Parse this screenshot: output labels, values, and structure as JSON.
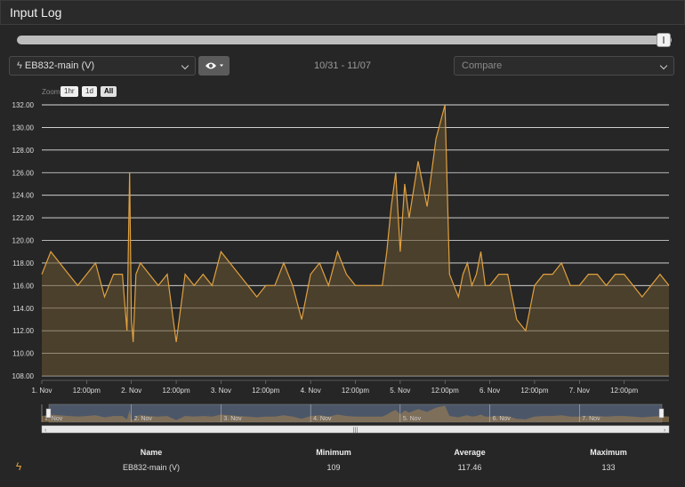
{
  "header": {
    "title": "Input Log"
  },
  "device_select": {
    "value": "EB832-main (V)"
  },
  "date_range": "10/31 - 11/07",
  "compare_select": {
    "placeholder": "Compare"
  },
  "zoom": {
    "label": "Zoom",
    "buttons": [
      "1hr",
      "1d",
      "All"
    ],
    "active": "All"
  },
  "colors": {
    "line": "#e0a040",
    "fill": "#6a5530",
    "grid": "#e6e6e6",
    "navigator": "#6a7ea0"
  },
  "chart_data": {
    "type": "area",
    "ylim": [
      108,
      132
    ],
    "yticks": [
      "108.00",
      "110.00",
      "112.00",
      "114.00",
      "116.00",
      "118.00",
      "120.00",
      "122.00",
      "124.00",
      "126.00",
      "128.00",
      "130.00",
      "132.00"
    ],
    "xticks": [
      "1. Nov",
      "12:00pm",
      "2. Nov",
      "12:00pm",
      "3. Nov",
      "12:00pm",
      "4. Nov",
      "12:00pm",
      "5. Nov",
      "12:00pm",
      "6. Nov",
      "12:00pm",
      "7. Nov",
      "12:00pm"
    ],
    "navigator_ticks": [
      "1. Nov",
      "2. Nov",
      "3. Nov",
      "4. Nov",
      "5. Nov",
      "6. Nov",
      "7. Nov"
    ],
    "x_days": [
      0,
      0.1,
      0.2,
      0.3,
      0.4,
      0.5,
      0.6,
      0.7,
      0.8,
      0.9,
      0.95,
      0.98,
      1.0,
      1.02,
      1.05,
      1.1,
      1.2,
      1.3,
      1.4,
      1.5,
      1.6,
      1.7,
      1.8,
      1.9,
      2.0,
      2.1,
      2.2,
      2.3,
      2.4,
      2.5,
      2.6,
      2.7,
      2.8,
      2.9,
      3.0,
      3.1,
      3.2,
      3.3,
      3.4,
      3.5,
      3.6,
      3.7,
      3.8,
      3.85,
      3.9,
      3.95,
      4.0,
      4.05,
      4.1,
      4.2,
      4.3,
      4.4,
      4.5,
      4.55,
      4.6,
      4.65,
      4.7,
      4.75,
      4.8,
      4.85,
      4.9,
      4.95,
      5.0,
      5.1,
      5.2,
      5.3,
      5.4,
      5.5,
      5.6,
      5.7,
      5.8,
      5.9,
      6.0,
      6.1,
      6.2,
      6.3,
      6.4,
      6.5,
      6.6,
      6.7,
      6.8,
      6.9,
      7.0
    ],
    "values": [
      117,
      119,
      118,
      117,
      116,
      117,
      118,
      115,
      117,
      117,
      112,
      126,
      113,
      111,
      117,
      118,
      117,
      116,
      117,
      111,
      117,
      116,
      117,
      116,
      119,
      118,
      117,
      116,
      115,
      116,
      116,
      118,
      116,
      113,
      117,
      118,
      116,
      119,
      117,
      116,
      116,
      116,
      116,
      119,
      123,
      126,
      119,
      125,
      122,
      127,
      123,
      129,
      132,
      117,
      116,
      115,
      117,
      118,
      116,
      117,
      119,
      116,
      116,
      117,
      117,
      113,
      112,
      116,
      117,
      117,
      118,
      116,
      116,
      117,
      117,
      116,
      117,
      117,
      116,
      115,
      116,
      117,
      116
    ],
    "min": 109,
    "max": 133
  },
  "stats": {
    "headers": [
      "Name",
      "Minimum",
      "Average",
      "Maximum"
    ],
    "row": {
      "name": "EB832-main (V)",
      "minimum": "109",
      "average": "117.46",
      "maximum": "133"
    }
  }
}
